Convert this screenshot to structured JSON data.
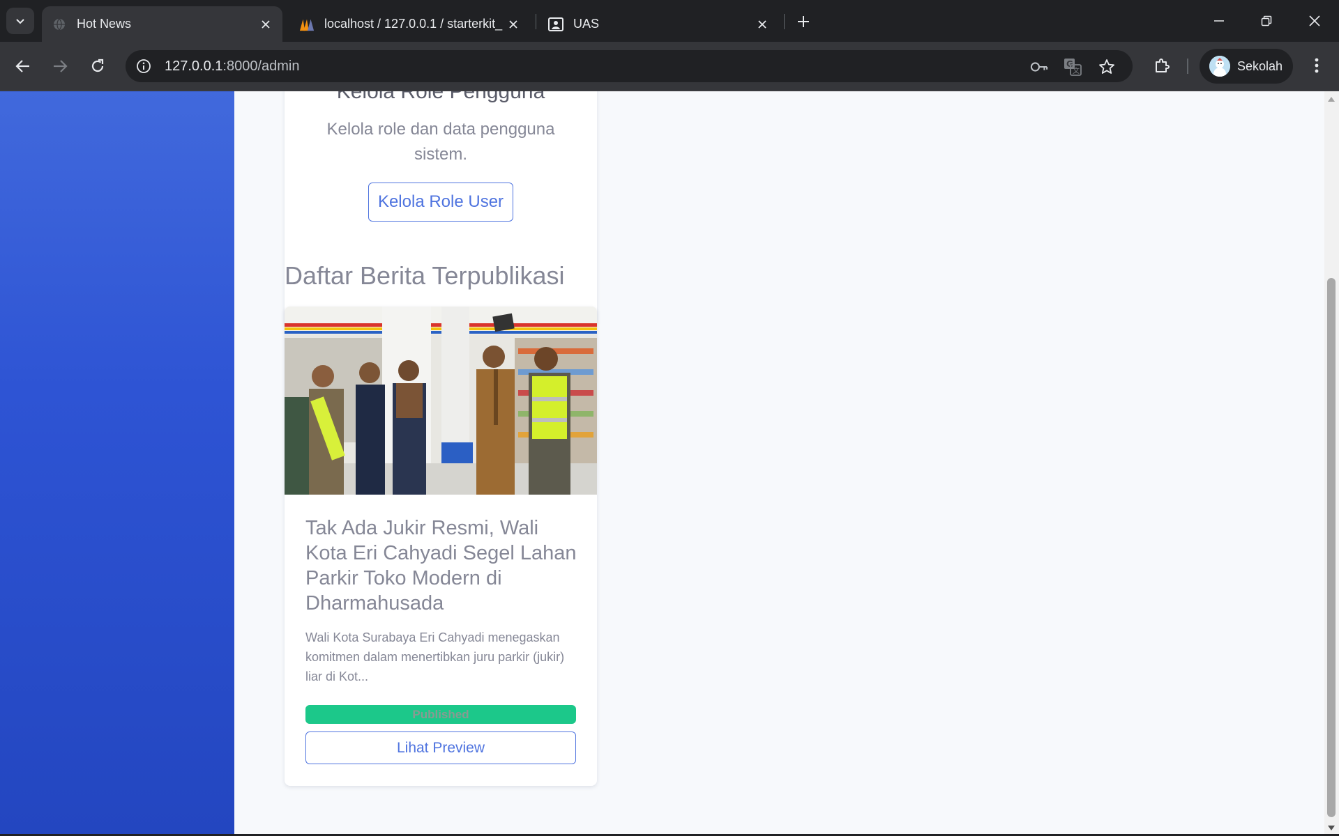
{
  "browser": {
    "tabs": [
      {
        "title": "Hot News",
        "active": true
      },
      {
        "title": "localhost / 127.0.0.1 / starterkit_",
        "active": false
      },
      {
        "title": "UAS",
        "active": false
      }
    ],
    "url_host": "127.0.0.1",
    "url_rest": ":8000/admin",
    "profile_name": "Sekolah"
  },
  "top_card": {
    "heading": "Kelola Role Pengguna",
    "description": "Kelola role dan data pengguna sistem.",
    "button_label": "Kelola Role User"
  },
  "section": {
    "title": "Daftar Berita Terpublikasi"
  },
  "news": [
    {
      "title": "Tak Ada Jukir Resmi, Wali Kota Eri Cahyadi Segel Lahan Parkir Toko Modern di Dharmahusada",
      "excerpt": "Wali Kota Surabaya Eri Cahyadi menegaskan komitmen dalam menertibkan juru parkir (jukir) liar di Kot...",
      "status": "Published",
      "button_label": "Lihat Preview"
    }
  ],
  "colors": {
    "sidebar_top": "#4169dc",
    "sidebar_bottom": "#2346c0",
    "primary": "#4e73df",
    "success": "#1cc88a",
    "text_muted": "#858796"
  }
}
